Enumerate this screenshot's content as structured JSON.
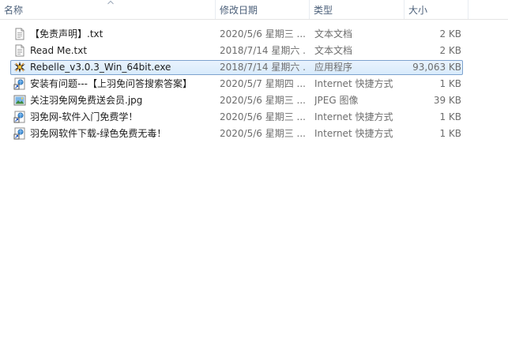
{
  "columns": {
    "name": "名称",
    "date": "修改日期",
    "type": "类型",
    "size": "大小"
  },
  "files": [
    {
      "icon": "text-file-icon",
      "name": "【免责声明】.txt",
      "date": "2020/5/6 星期三 ...",
      "type": "文本文档",
      "size": "2 KB"
    },
    {
      "icon": "text-file-icon",
      "name": "Read Me.txt",
      "date": "2018/7/14 星期六 ...",
      "type": "文本文档",
      "size": "2 KB"
    },
    {
      "icon": "exe-app-icon",
      "name": "Rebelle_v3.0.3_Win_64bit.exe",
      "date": "2018/7/14 星期六 ...",
      "type": "应用程序",
      "size": "93,063 KB",
      "selected": true
    },
    {
      "icon": "internet-shortcut-icon",
      "name": "安装有问题---【上羽免问答搜索答案】",
      "date": "2020/5/7 星期四 ...",
      "type": "Internet 快捷方式",
      "size": "1 KB"
    },
    {
      "icon": "image-file-icon",
      "name": "关注羽免网免费送会员.jpg",
      "date": "2020/5/6 星期三 ...",
      "type": "JPEG 图像",
      "size": "39 KB"
    },
    {
      "icon": "internet-shortcut-icon",
      "name": "羽免网-软件入门免费学！",
      "date": "2020/5/6 星期三 ...",
      "type": "Internet 快捷方式",
      "size": "1 KB"
    },
    {
      "icon": "internet-shortcut-icon",
      "name": "羽免网软件下载-绿色免费无毒！",
      "date": "2020/5/6 星期三 ...",
      "type": "Internet 快捷方式",
      "size": "1 KB"
    }
  ]
}
